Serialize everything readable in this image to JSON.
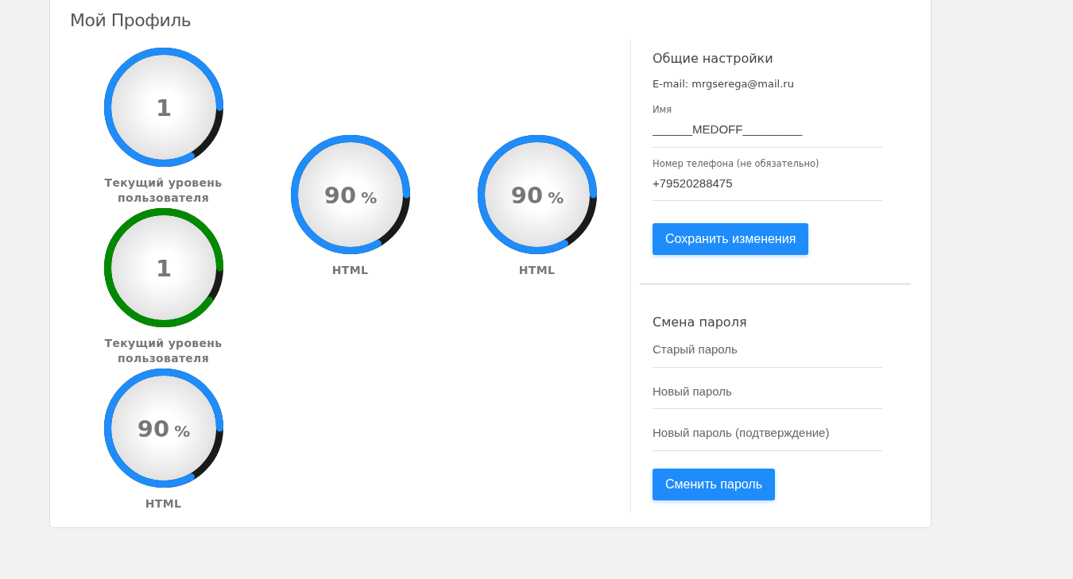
{
  "title": "Мой Профиль",
  "gauge_columns": [
    [
      {
        "value": "1",
        "level": 0.83,
        "color": "#1e8cfa",
        "label": "Текущий уровень пользователя"
      },
      {
        "value": "1",
        "level": 0.9,
        "color": "#008a00",
        "label": "Текущий уровень пользователя"
      },
      {
        "value": "90",
        "unit": "%",
        "level": 0.83,
        "color": "#1e8cfa",
        "label": "HTML"
      }
    ],
    [
      {
        "value": "90",
        "unit": "%",
        "level": 0.83,
        "color": "#1e8cfa",
        "label": "HTML"
      }
    ],
    [
      {
        "value": "90",
        "unit": "%",
        "level": 0.83,
        "color": "#1e8cfa",
        "label": "HTML"
      }
    ]
  ],
  "general": {
    "heading": "Общие настройки",
    "email": "E-mail: mrgserega@mail.ru",
    "fields": [
      {
        "label": "Имя",
        "value": "______MEDOFF_________"
      },
      {
        "label": "Номер телефона (не обязательно)",
        "value": "+79520288475"
      }
    ],
    "button": "Сохранить изменения"
  },
  "password": {
    "heading": "Смена пароля",
    "fields": [
      {
        "placeholder": "Старый пароль"
      },
      {
        "placeholder": "Новый пароль"
      },
      {
        "placeholder": "Новый пароль (подтверждение)"
      }
    ],
    "button": "Сменить пароль"
  }
}
